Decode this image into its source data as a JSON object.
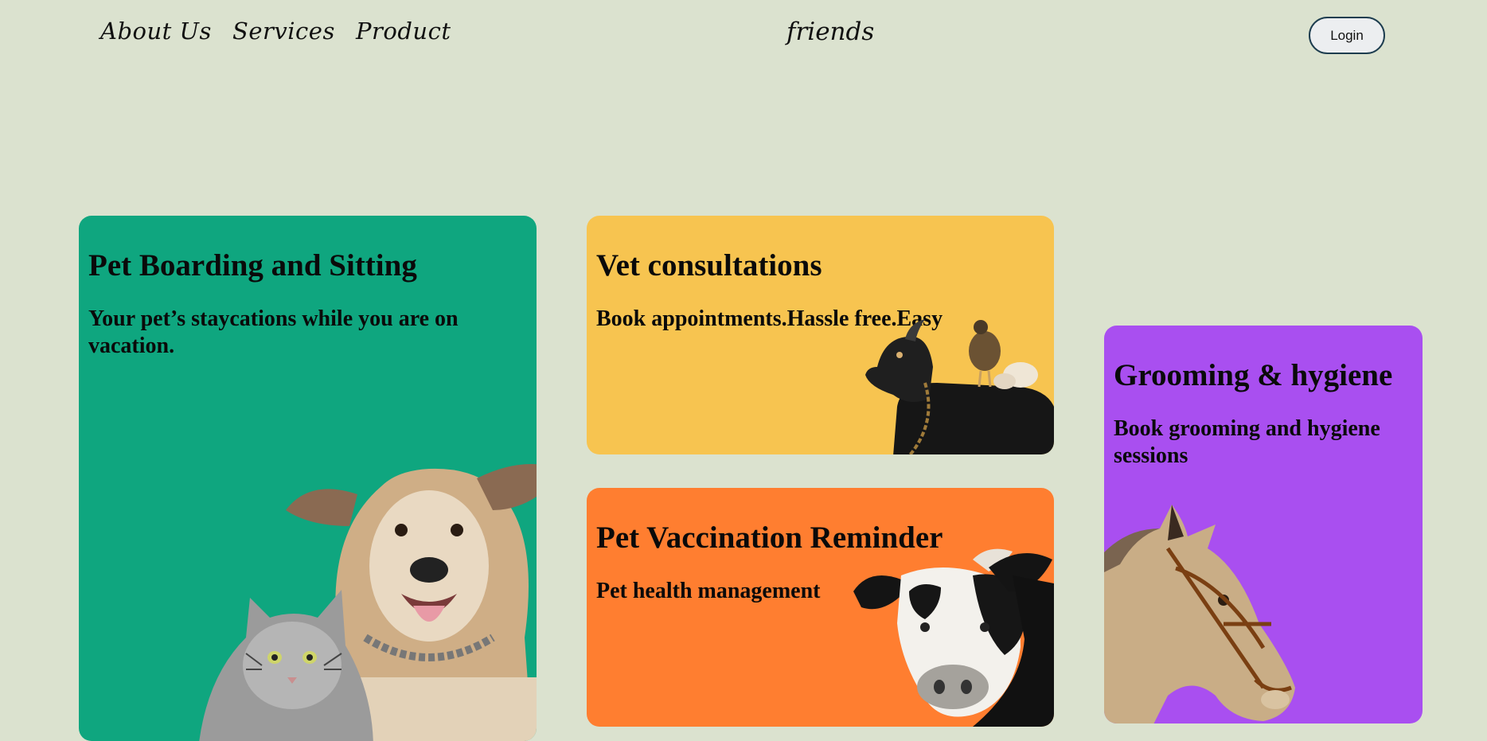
{
  "nav": {
    "links": [
      {
        "label": "About Us"
      },
      {
        "label": "Services"
      },
      {
        "label": "Product"
      }
    ],
    "brand": "friends",
    "login_label": "Login"
  },
  "cards": [
    {
      "title": "Pet Boarding and Sitting",
      "subtitle": "Your pet’s staycations while you are on vacation.",
      "color": "#0fa67f",
      "image": "cat-and-dog-illustration"
    },
    {
      "title": "Vet consultations",
      "subtitle": "Book appointments.Hassle free.Easy",
      "color": "#f7c450",
      "image": "goat-and-chicken-illustration"
    },
    {
      "title": "Pet Vaccination Reminder",
      "subtitle": "Pet health management",
      "color": "#ff7e30",
      "image": "cow-illustration"
    },
    {
      "title": "Grooming & hygiene",
      "subtitle": "Book grooming and hygiene sessions",
      "color": "#a94ff0",
      "image": "horse-illustration"
    }
  ]
}
